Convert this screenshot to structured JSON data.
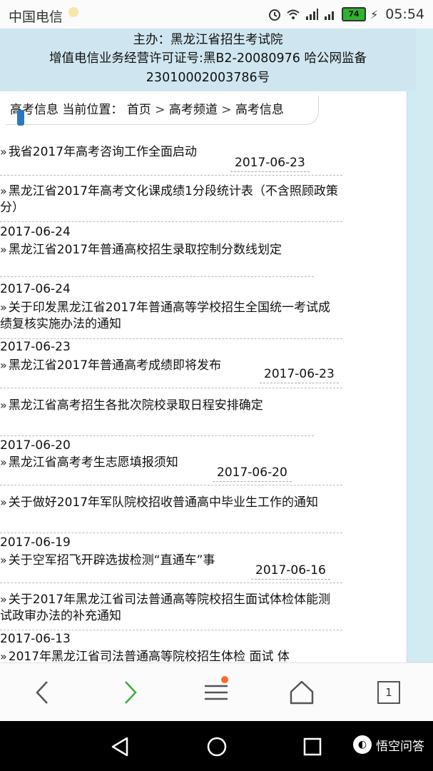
{
  "status_bar": {
    "carrier": "中国电信",
    "battery": "74",
    "time": "05:54"
  },
  "header": {
    "line1": "主办：黑龙江省招生考试院",
    "line2": "增值电信业务经营许可证号:黑B2-20080976 哈公网监备",
    "line3": "23010002003786号"
  },
  "breadcrumb": {
    "section": "高考信息",
    "location_label": "当前位置：",
    "home": "首页",
    "sep": ">",
    "channel": "高考频道",
    "current": "高考信息"
  },
  "news": [
    {
      "bullet": "»",
      "title": "我省2017年高考咨询工作全面启动",
      "date": "2017-06-23"
    },
    {
      "bullet": "»",
      "title": "黑龙江省2017年高考文化课成绩1分段统计表（不含照顾政策分）",
      "date": "2017-06-24"
    },
    {
      "bullet": "»",
      "title": "黑龙江省2017年普通高校招生录取控制分数线划定",
      "date": "2017-06-24"
    },
    {
      "bullet": "»",
      "title": "关于印发黑龙江省2017年普通高等学校招生全国统一考试成绩复核实施办法的通知",
      "date": "2017-06-23"
    },
    {
      "bullet": "»",
      "title": "黑龙江省2017年普通高考成绩即将发布",
      "date": "2017-06-23"
    },
    {
      "bullet": "»",
      "title": "黑龙江省高考招生各批次院校录取日程安排确定",
      "date": "2017-06-20"
    },
    {
      "bullet": "»",
      "title": "黑龙江省高考考生志愿填报须知",
      "date": "2017-06-20"
    },
    {
      "bullet": "»",
      "title": "关于做好2017年军队院校招收普通高中毕业生工作的通知",
      "date": "2017-06-19"
    },
    {
      "bullet": "»",
      "title": "关于空军招飞开辟选拔检测“直通车”事",
      "date": "2017-06-16"
    },
    {
      "bullet": "»",
      "title": "关于2017年黑龙江省司法普通高等院校招生面试体检体能测试政审办法的补充通知",
      "date": "2017-06-13"
    },
    {
      "bullet": "»",
      "title": "2017年黑龙江省司法普通高等院校招生体检 面试 体"
    }
  ],
  "toolbar": {
    "tab_count": "1"
  },
  "watermark": {
    "text": "悟空问答"
  },
  "colors": {
    "page_bg": "#d2ebf3",
    "notification_dot": "#ff6a2a",
    "battery": "#2eb32e"
  }
}
